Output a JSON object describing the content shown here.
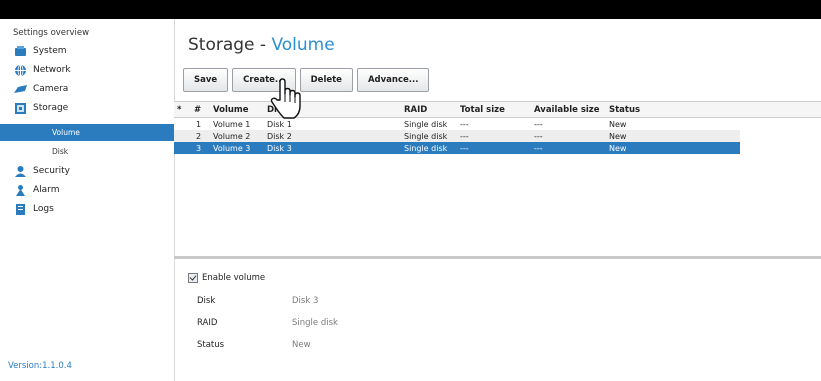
{
  "sidebar": {
    "title": "Settings overview",
    "items": [
      {
        "label": "System",
        "icon": "system-icon"
      },
      {
        "label": "Network",
        "icon": "network-icon"
      },
      {
        "label": "Camera",
        "icon": "camera-icon"
      },
      {
        "label": "Storage",
        "icon": "storage-icon"
      },
      {
        "label": "Security",
        "icon": "security-icon"
      },
      {
        "label": "Alarm",
        "icon": "alarm-icon"
      },
      {
        "label": "Logs",
        "icon": "logs-icon"
      }
    ],
    "storage_sub": [
      {
        "label": "Volume",
        "active": true
      },
      {
        "label": "Disk",
        "active": false
      }
    ],
    "version": "Version:1.1.0.4"
  },
  "page": {
    "title_prefix": "Storage - ",
    "title_accent": "Volume",
    "accent_color": "#2b8fd0",
    "selection_color": "#2b7bbf"
  },
  "toolbar": {
    "save": "Save",
    "create": "Create...",
    "delete": "Delete",
    "advance": "Advance..."
  },
  "table": {
    "headers": {
      "star": "*",
      "num": "#",
      "volume": "Volume",
      "disk": "Disk",
      "raid": "RAID",
      "total": "Total size",
      "available": "Available size",
      "status": "Status"
    },
    "rows": [
      {
        "num": "1",
        "volume": "Volume 1",
        "disk": "Disk 1",
        "raid": "Single disk",
        "total": "---",
        "available": "---",
        "status": "New"
      },
      {
        "num": "2",
        "volume": "Volume 2",
        "disk": "Disk 2",
        "raid": "Single disk",
        "total": "---",
        "available": "---",
        "status": "New"
      },
      {
        "num": "3",
        "volume": "Volume 3",
        "disk": "Disk 3",
        "raid": "Single disk",
        "total": "---",
        "available": "---",
        "status": "New"
      }
    ],
    "selected_row": 3
  },
  "detail": {
    "enable_label": "Enable volume",
    "enabled": true,
    "disk_label": "Disk",
    "disk_value": "Disk 3",
    "raid_label": "RAID",
    "raid_value": "Single disk",
    "status_label": "Status",
    "status_value": "New"
  }
}
